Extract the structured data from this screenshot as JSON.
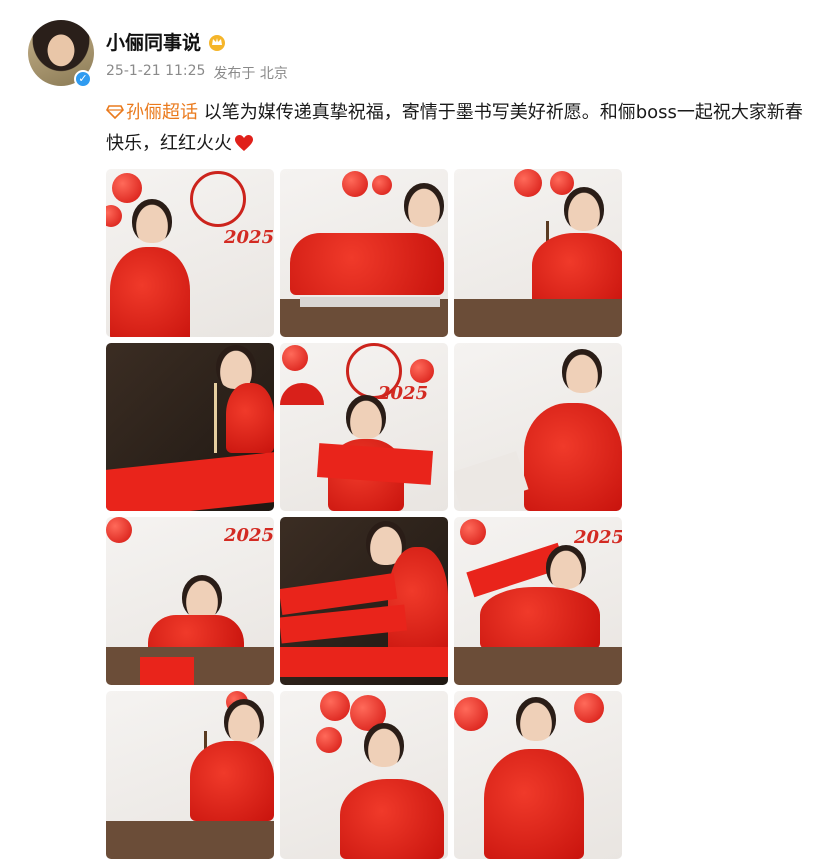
{
  "post": {
    "username": "小俪同事说",
    "date": "25-1-21 11:25",
    "source": "发布于 北京",
    "topic": "孙俪超话",
    "text": " 以笔为媒传递真挚祝福，寄情于墨书写美好祈愿。和俪boss一起祝大家新春快乐，红红火火"
  },
  "icons": {
    "avatar": "profile-avatar",
    "verified": "verified-badge-icon",
    "crown": "crown-badge-icon",
    "topic": "diamond-topic-icon",
    "heart": "red-heart-emoji"
  },
  "colors": {
    "topic": "#ea7a1d",
    "verified": "#2f9bf0",
    "accent_red": "#d9201a",
    "meta_gray": "#8a8a8a"
  },
  "photos": [
    {
      "scene": "portrait-seated-smiling"
    },
    {
      "scene": "reaching-across-table"
    },
    {
      "scene": "writing-calligraphy"
    },
    {
      "scene": "closeup-brush-dark"
    },
    {
      "scene": "holding-red-banner"
    },
    {
      "scene": "side-profile-smile"
    },
    {
      "scene": "writing-at-table"
    },
    {
      "scene": "couplets-on-table"
    },
    {
      "scene": "holding-couplet-up"
    },
    {
      "scene": "writing-closeup"
    },
    {
      "scene": "laughing-portrait"
    },
    {
      "scene": "standing-portrait"
    }
  ]
}
